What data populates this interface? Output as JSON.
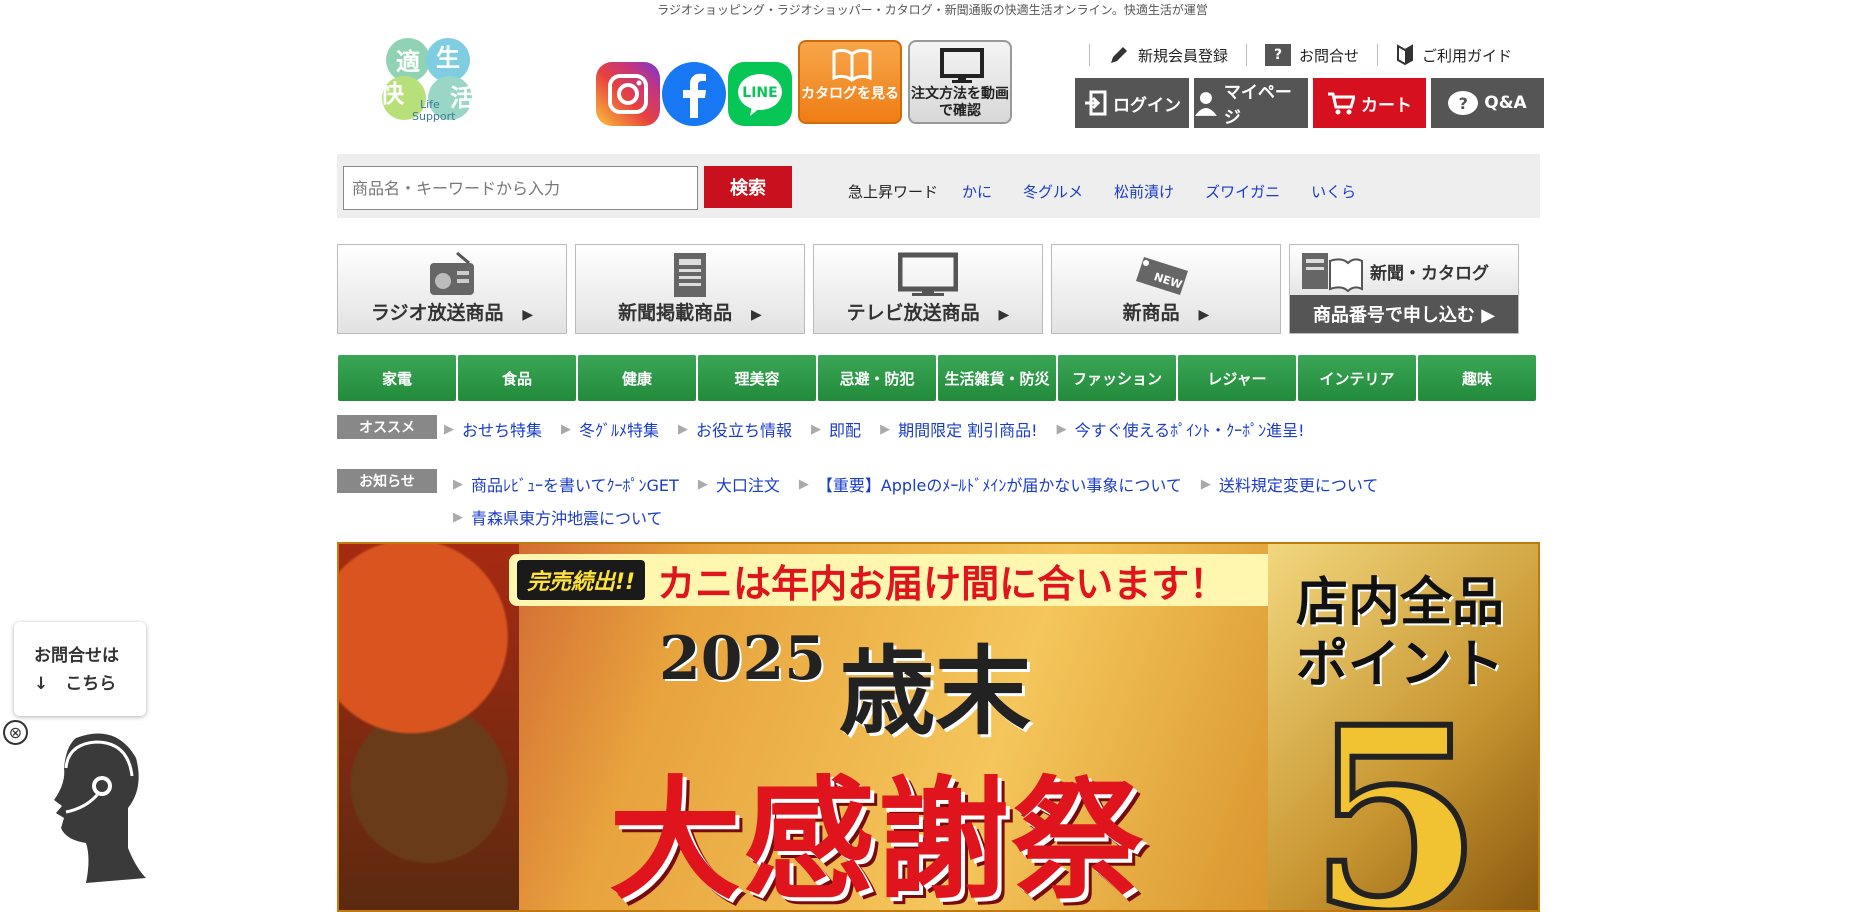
{
  "tagline": "ラジオショッピング・ラジオショッパー・カタログ・新聞通販の快適生活オンライン。快適生活が運営",
  "logo": {
    "chars": [
      "適",
      "生",
      "快",
      "活"
    ],
    "sub1": "Life",
    "sub2": "Support"
  },
  "header": {
    "catalog_btn": "カタログを見る",
    "video_btn": "注文方法を動画で確認",
    "links": {
      "register": "新規会員登録",
      "contact": "お問合せ",
      "guide": "ご利用ガイド"
    },
    "qbox": "?",
    "account": {
      "login": "ログイン",
      "mypage": "マイページ",
      "cart": "カート",
      "qa": "Q&A",
      "qa_icon": "?"
    }
  },
  "search": {
    "placeholder": "商品名・キーワードから入力",
    "button": "検索",
    "trend_label": "急上昇ワード",
    "trend_words": [
      "かに",
      "冬グルメ",
      "松前漬け",
      "ズワイガニ",
      "いくら"
    ]
  },
  "media": {
    "radio": "ラジオ放送商品",
    "newspaper": "新聞掲載商品",
    "tv": "テレビ放送商品",
    "new": "新商品",
    "new_tag": "NEW",
    "catalog_top": "新聞・カタログ",
    "catalog_bottom": "商品番号で申し込む ▶"
  },
  "categories": [
    "家電",
    "食品",
    "健康",
    "理美容",
    "忌避・防犯",
    "生活雑貨・防災",
    "ファッション",
    "レジャー",
    "インテリア",
    "趣味"
  ],
  "recommend": {
    "label": "オススメ",
    "items": [
      "おせち特集",
      "冬ｸﾞﾙﾒ特集",
      "お役立ち情報",
      "即配",
      "期間限定 割引商品!",
      "今すぐ使えるﾎﾟｲﾝﾄ・ｸｰﾎﾟﾝ進呈!"
    ]
  },
  "notice": {
    "label": "お知らせ",
    "items": [
      "商品ﾚﾋﾞｭｰを書いてｸｰﾎﾟﾝGET",
      "大口注文",
      "【重要】Appleのﾒｰﾙﾄﾞﾒｲﾝが届かない事象について",
      "送料規定変更について",
      "青森県東方沖地震について"
    ]
  },
  "banner": {
    "badge": "完売続出!!",
    "headline": "カニは年内お届け間に合います！",
    "year": "2025",
    "saimatsu": "歳末",
    "daikansha": "大感謝祭",
    "point_line1": "店内全品",
    "point_line2": "ポイント",
    "multiplier": "5"
  },
  "contact_widget": {
    "line1": "お問合せは",
    "line2": "↓　こちら",
    "close": "⊗"
  },
  "colors": {
    "accent_red": "#d6101f",
    "nav_green": "#2e9a48",
    "link_blue": "#1a3cc8",
    "dark_gray": "#555555"
  }
}
